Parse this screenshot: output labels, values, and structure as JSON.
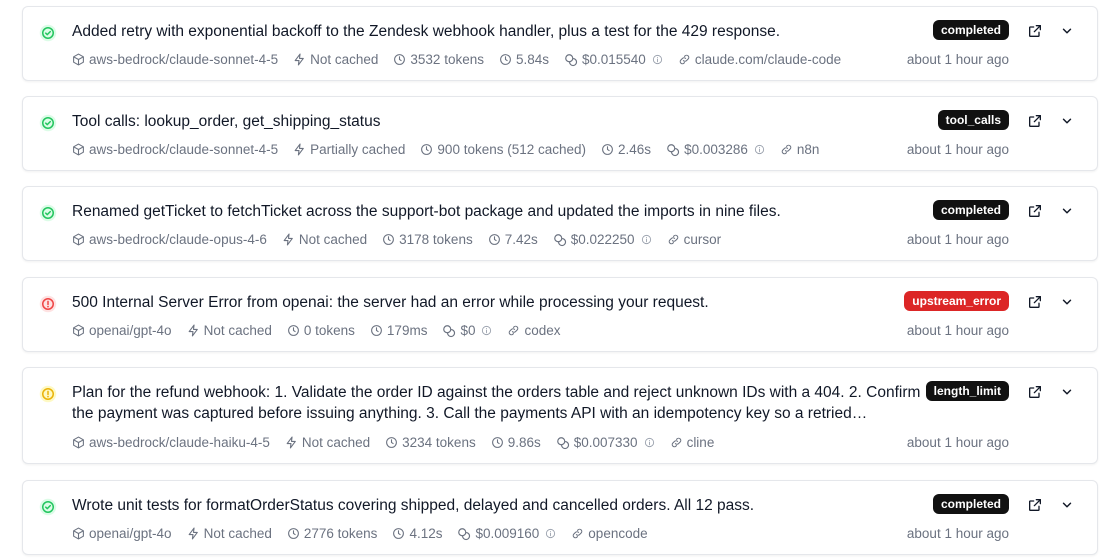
{
  "colors": {
    "success": "#22c55e",
    "error": "#ef4444",
    "warning": "#eab308",
    "badge_dark": "#111111",
    "badge_error": "#dc2626",
    "muted_text": "#6b7280"
  },
  "rows": [
    {
      "status": "success",
      "status_icon": "check-circle-icon",
      "title": "Added retry with exponential backoff to the Zendesk webhook handler, plus a test for the 429 response.",
      "badge": "completed",
      "model": "aws-bedrock/claude-sonnet-4-5",
      "cache": "Not cached",
      "tokens": "3532 tokens",
      "duration": "5.84s",
      "cost": "$0.015540",
      "source": "claude.com/claude-code",
      "time": "about 1 hour ago"
    },
    {
      "status": "success",
      "status_icon": "check-circle-icon",
      "title": "Tool calls: lookup_order, get_shipping_status",
      "badge": "tool_calls",
      "model": "aws-bedrock/claude-sonnet-4-5",
      "cache": "Partially cached",
      "tokens": "900 tokens (512 cached)",
      "duration": "2.46s",
      "cost": "$0.003286",
      "source": "n8n",
      "time": "about 1 hour ago"
    },
    {
      "status": "success",
      "status_icon": "check-circle-icon",
      "title": "Renamed getTicket to fetchTicket across the support-bot package and updated the imports in nine files.",
      "badge": "completed",
      "model": "aws-bedrock/claude-opus-4-6",
      "cache": "Not cached",
      "tokens": "3178 tokens",
      "duration": "7.42s",
      "cost": "$0.022250",
      "source": "cursor",
      "time": "about 1 hour ago"
    },
    {
      "status": "error",
      "status_icon": "alert-circle-icon",
      "title": "500 Internal Server Error from openai: the server had an error while processing your request.",
      "badge": "upstream_error",
      "model": "openai/gpt-4o",
      "cache": "Not cached",
      "tokens": "0 tokens",
      "duration": "179ms",
      "cost": "$0",
      "source": "codex",
      "time": "about 1 hour ago"
    },
    {
      "status": "warning",
      "status_icon": "alert-circle-icon",
      "title": "Plan for the refund webhook: 1. Validate the order ID against the orders table and reject unknown IDs with a 404. 2. Confirm the payment was captured before issuing anything. 3. Call the payments API with an idempotency key so a retried webhook…",
      "badge": "length_limit",
      "model": "aws-bedrock/claude-haiku-4-5",
      "cache": "Not cached",
      "tokens": "3234 tokens",
      "duration": "9.86s",
      "cost": "$0.007330",
      "source": "cline",
      "time": "about 1 hour ago"
    },
    {
      "status": "success",
      "status_icon": "check-circle-icon",
      "title": "Wrote unit tests for formatOrderStatus covering shipped, delayed and cancelled orders. All 12 pass.",
      "badge": "completed",
      "model": "openai/gpt-4o",
      "cache": "Not cached",
      "tokens": "2776 tokens",
      "duration": "4.12s",
      "cost": "$0.009160",
      "source": "opencode",
      "time": "about 1 hour ago"
    }
  ]
}
